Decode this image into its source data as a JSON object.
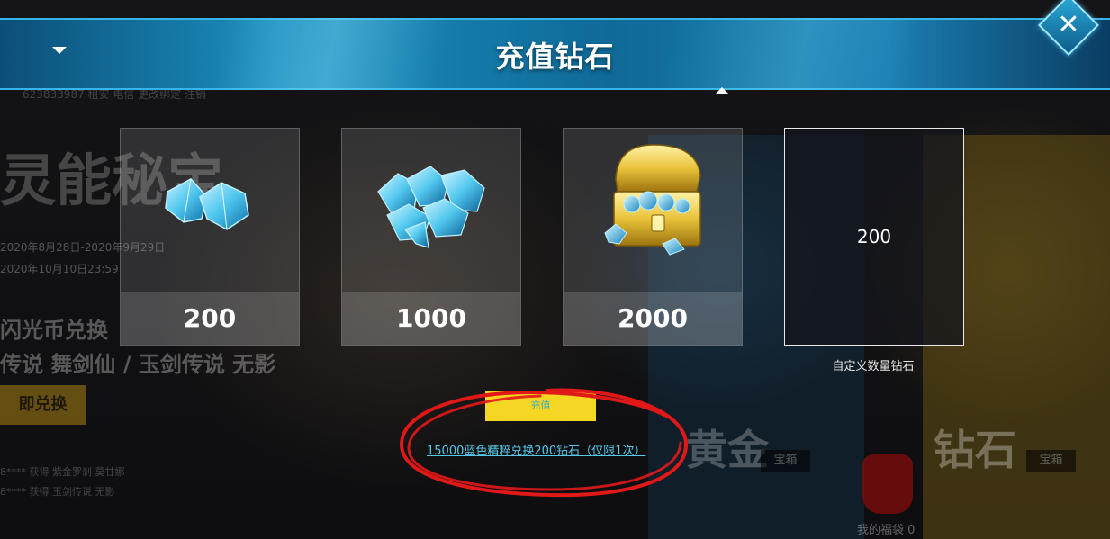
{
  "banner": {
    "title": "充值钻石"
  },
  "close": {
    "icon": "close-icon",
    "glyph": "✕"
  },
  "cards": [
    {
      "amount": "200",
      "icon": "small-diamonds-icon"
    },
    {
      "amount": "1000",
      "icon": "diamond-pile-icon"
    },
    {
      "amount": "2000",
      "icon": "treasure-chest-icon"
    }
  ],
  "custom": {
    "value": "200",
    "label": "自定义数量钻石"
  },
  "actions": {
    "recharge_label": "充值",
    "exchange_link": "15000蓝色精粹兑换200钻石（仅限1次）"
  },
  "background": {
    "title": "灵能秘宝",
    "date1": "2020年8月28日-2020年9月29日",
    "date2": "2020年10月10日23:59",
    "subtitle": "闪光币兑换",
    "heroes": "传说 舞剑仙 / 玉剑传说 无影",
    "button": "即兑换",
    "feed": [
      "8**** 获得 紫金罗刹 莫甘娜",
      "8**** 获得 玉剑传说 无影"
    ],
    "gold_label": "黄金",
    "diamond_label": "钻石",
    "chest_label": "宝箱",
    "bag_label": "我的福袋 0",
    "top_info": "623833987  租安 电信  更改绑定  注销"
  },
  "colors": {
    "accent": "#f4d623",
    "link": "#56c8e8",
    "banner": "#1c8fbf",
    "annotation": "#e01818"
  }
}
